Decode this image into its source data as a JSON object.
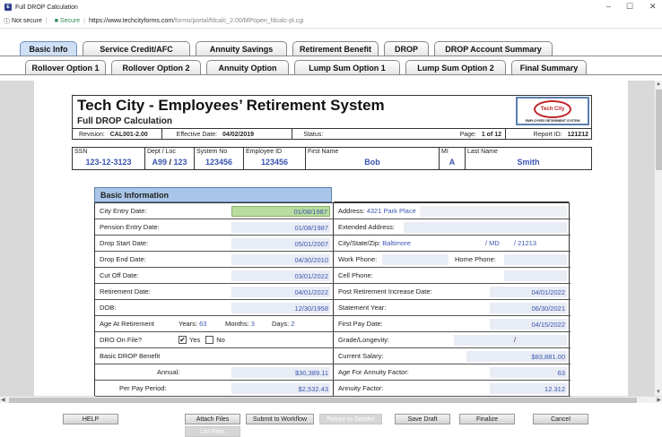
{
  "browser": {
    "title": "Full DROP Calculation",
    "not_secure": "Not secure",
    "secure": "Secure",
    "url_host": "https://www.techcityforms.com",
    "url_path": "/forms/portal/fdcalc_2.00/MPopen_fdcalc-pl.cgi"
  },
  "tabs_row1": [
    "Basic Info",
    "Service Credit/AFC",
    "Annuity Savings",
    "Retirement Benefit",
    "DROP",
    "DROP Account Summary"
  ],
  "tabs_row2": [
    "Rollover Option 1",
    "Rollover Option 2",
    "Annuity Option",
    "Lump Sum Option 1",
    "Lump Sum Option 2",
    "Final Summary"
  ],
  "header": {
    "title": "Tech City - Employees’ Retirement System",
    "subtitle": "Full DROP Calculation",
    "revision_label": "Revision:",
    "revision_value": "CAL001-2.00",
    "effective_label": "Effective Date:",
    "effective_value": "04/02/2019",
    "status_label": "Status:",
    "page_label": "Page:",
    "page_value": "1 of 12",
    "report_label": "Report ID:",
    "report_value": "121212",
    "logo_text": "Tech City",
    "logo_caption": "EMPLOYEES RETIREMENT SYSTEM"
  },
  "ids": {
    "ssn_label": "SSN",
    "ssn": "123-12-3123",
    "dept_label": "Dept / Loc",
    "dept": "A99",
    "slash": "/",
    "loc": "123",
    "system_label": "System No",
    "system": "123456",
    "employee_label": "Employee ID",
    "employee": "123456",
    "first_label": "First Name",
    "first": "Bob",
    "mi_label": "MI",
    "mi": "A",
    "last_label": "Last Name",
    "last": "Smith"
  },
  "section_title": "Basic Information",
  "left": {
    "city_entry_label": "City Entry Date:",
    "city_entry": "01/08/1987",
    "pension_entry_label": "Pension Entry Date:",
    "pension_entry": "01/08/1987",
    "drop_start_label": "Drop Start Date:",
    "drop_start": "05/01/2007",
    "drop_end_label": "Drop End Date:",
    "drop_end": "04/30/2010",
    "cutoff_label": "Cut Off Date:",
    "cutoff": "03/01/2022",
    "retirement_label": "Retirement Date:",
    "retirement": "04/01/2022",
    "dob_label": "DOB:",
    "dob": "12/30/1958",
    "age_label": "Age At Retirement",
    "years_label": "Years:",
    "years": "63",
    "months_label": "Months:",
    "months": "3",
    "days_label": "Days:",
    "days": "2",
    "dro_label": "DRO On File?",
    "yes_label": "Yes",
    "no_label": "No",
    "basic_drop_label": "Basic DROP Benefit",
    "annual_label": "Annual:",
    "annual": "$30,389.11",
    "per_pay_label": "Per Pay Period:",
    "per_pay": "$2,532.43"
  },
  "right": {
    "address_label": "Address:",
    "address": "4321 Park Place",
    "ext_address_label": "Extended Address:",
    "csz_label": "City/State/Zip:",
    "city": "Baltimore",
    "state": "/ MD",
    "zip": "/ 21213",
    "work_phone_label": "Work Phone:",
    "home_phone_label": "Home Phone:",
    "cell_phone_label": "Cell Phone:",
    "pri_label": "Post Retirement Increase Date:",
    "pri": "04/01/2022",
    "statement_label": "Statement Year:",
    "statement": "06/30/2021",
    "first_pay_label": "First Pay Date:",
    "first_pay": "04/15/2022",
    "grade_label": "Grade/Longevity:",
    "grade_sep": "/",
    "salary_label": "Current Salary:",
    "salary": "$83,881.00",
    "age_factor_label": "Age For Annuity Factor:",
    "age_factor": "63",
    "annuity_factor_label": "Annuity Factor:",
    "annuity_factor": "12.312"
  },
  "footer": {
    "help": "HELP",
    "attach": "Attach Files",
    "list": "List Files",
    "workflow": "Submit to Workflow",
    "return": "Return to Sender",
    "save": "Save Draft",
    "finalize": "Finalize",
    "cancel": "Cancel"
  }
}
